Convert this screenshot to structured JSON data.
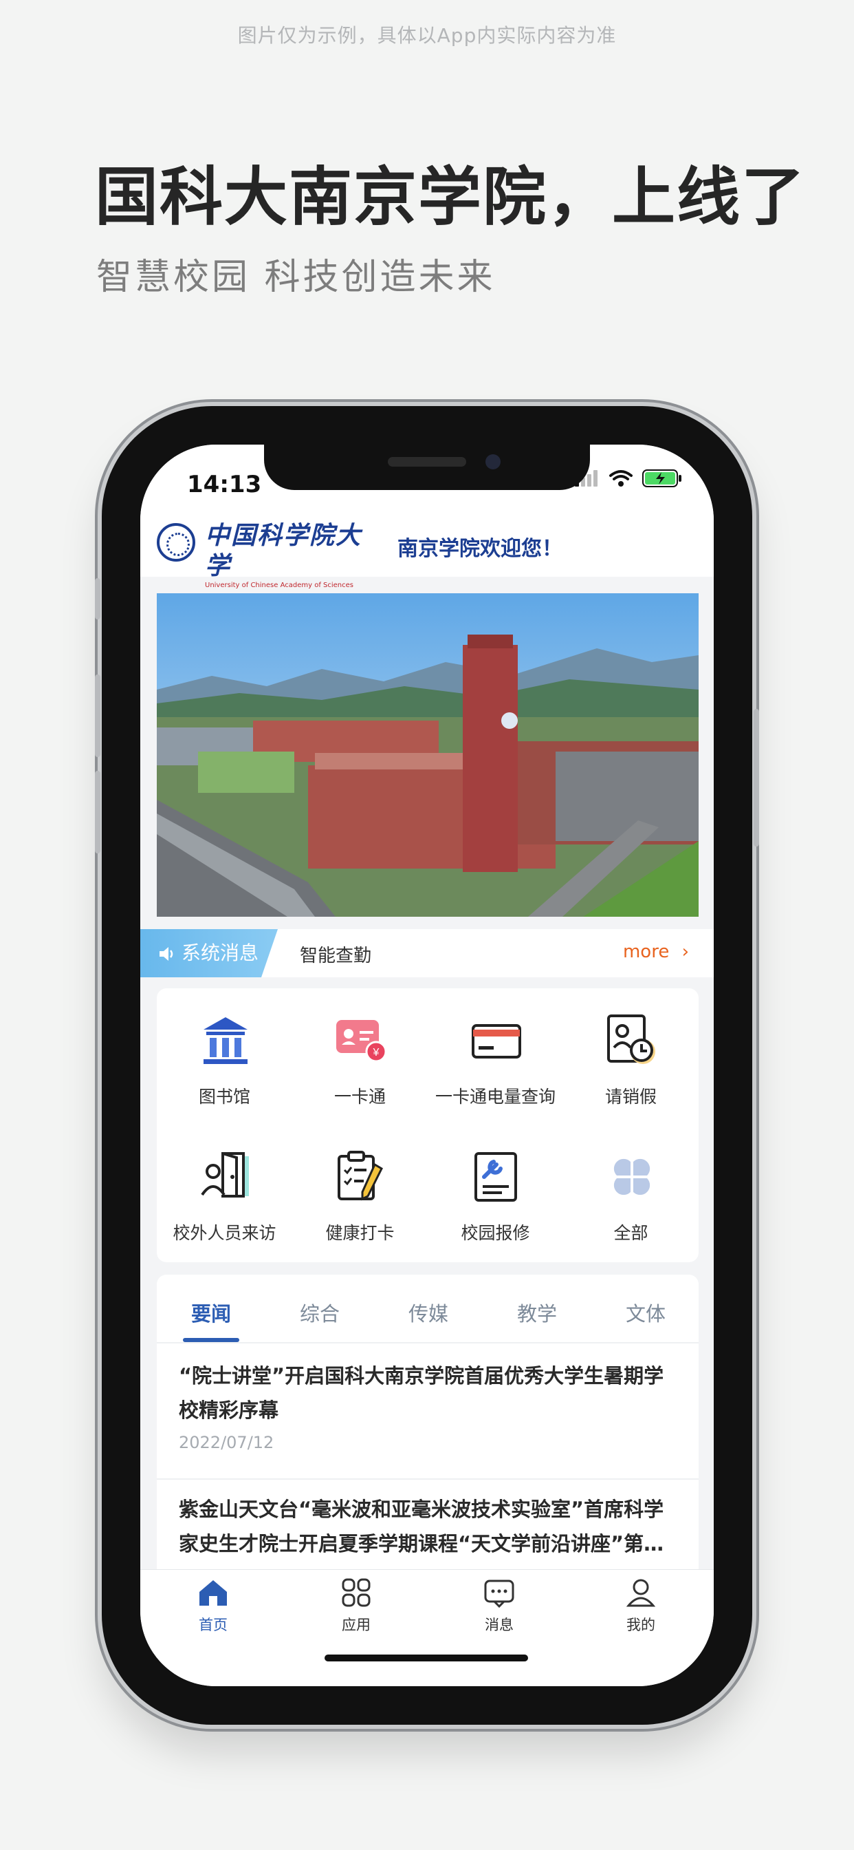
{
  "promo": {
    "disclaimer": "图片仅为示例，具体以App内实际内容为准",
    "headline": "国科大南京学院，上线了",
    "subline": "智慧校园  科技创造未来"
  },
  "status_bar": {
    "time": "14:13"
  },
  "header": {
    "logo_cn": "中国科学院大学",
    "logo_en": "University of Chinese Academy of Sciences",
    "welcome": "南京学院欢迎您！"
  },
  "notice": {
    "tag": "系统消息",
    "text": "智能查勤",
    "more": "more"
  },
  "services": [
    {
      "label": "图书馆",
      "icon": "library-icon"
    },
    {
      "label": "一卡通",
      "icon": "campus-card-icon"
    },
    {
      "label": "一卡通电量查询",
      "icon": "card-balance-icon"
    },
    {
      "label": "请销假",
      "icon": "leave-request-icon"
    },
    {
      "label": "校外人员来访",
      "icon": "visitor-icon"
    },
    {
      "label": "健康打卡",
      "icon": "health-checkin-icon"
    },
    {
      "label": "校园报修",
      "icon": "repair-icon"
    },
    {
      "label": "全部",
      "icon": "all-apps-icon"
    }
  ],
  "news_tabs": [
    "要闻",
    "综合",
    "传媒",
    "教学",
    "文体"
  ],
  "news": [
    {
      "title": "“院士讲堂”开启国科大南京学院首届优秀大学生暑期学校精彩序幕",
      "date": "2022/07/12"
    },
    {
      "title": "紫金山天文台“毫米波和亚毫米波技术实验室”首席科学家史生才院士开启夏季学期课程“天文学前沿讲座”第…",
      "date": ""
    }
  ],
  "tabbar": [
    {
      "label": "首页",
      "icon": "home-icon"
    },
    {
      "label": "应用",
      "icon": "apps-icon"
    },
    {
      "label": "消息",
      "icon": "message-icon"
    },
    {
      "label": "我的",
      "icon": "profile-icon"
    }
  ],
  "colors": {
    "brand_blue": "#1c3e92",
    "accent_blue": "#2c5db3",
    "notice_blue": "#68b8ec",
    "more_orange": "#e8631f"
  }
}
